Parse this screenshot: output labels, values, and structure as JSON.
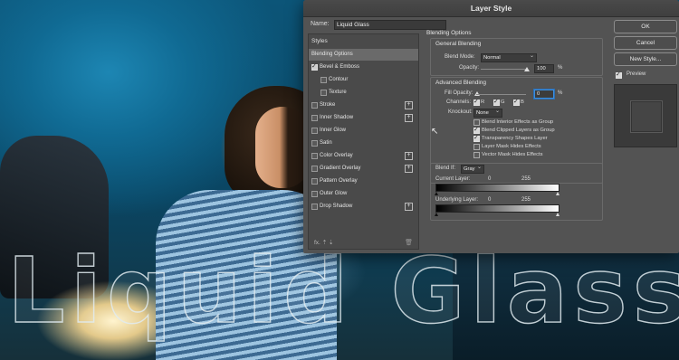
{
  "dialog": {
    "title": "Layer Style",
    "name_label": "Name:",
    "name_value": "Liquid Glass",
    "styles_header": "Styles",
    "styles": [
      {
        "label": "Blending Options",
        "checkbox": false,
        "checked": false,
        "plus": false,
        "selected": true
      },
      {
        "label": "Bevel & Emboss",
        "checkbox": true,
        "checked": true,
        "plus": false
      },
      {
        "label": "Contour",
        "checkbox": true,
        "checked": false,
        "plus": false,
        "indent": true
      },
      {
        "label": "Texture",
        "checkbox": true,
        "checked": false,
        "plus": false,
        "indent": true
      },
      {
        "label": "Stroke",
        "checkbox": true,
        "checked": false,
        "plus": true
      },
      {
        "label": "Inner Shadow",
        "checkbox": true,
        "checked": false,
        "plus": true
      },
      {
        "label": "Inner Glow",
        "checkbox": true,
        "checked": false,
        "plus": false
      },
      {
        "label": "Satin",
        "checkbox": true,
        "checked": false,
        "plus": false
      },
      {
        "label": "Color Overlay",
        "checkbox": true,
        "checked": false,
        "plus": true
      },
      {
        "label": "Gradient Overlay",
        "checkbox": true,
        "checked": false,
        "plus": true
      },
      {
        "label": "Pattern Overlay",
        "checkbox": true,
        "checked": false,
        "plus": false
      },
      {
        "label": "Outer Glow",
        "checkbox": true,
        "checked": false,
        "plus": false
      },
      {
        "label": "Drop Shadow",
        "checkbox": true,
        "checked": false,
        "plus": true
      }
    ],
    "footer_fx": "fx.",
    "blending": {
      "section_title": "Blending Options",
      "general_title": "General Blending",
      "blend_mode_label": "Blend Mode:",
      "blend_mode_value": "Normal",
      "opacity_label": "Opacity:",
      "opacity_value": "100",
      "pct": "%",
      "advanced_title": "Advanced Blending",
      "fill_opacity_label": "Fill Opacity:",
      "fill_opacity_value": "0",
      "channels_label": "Channels:",
      "channel_r": "R",
      "channel_g": "G",
      "channel_b": "B",
      "knockout_label": "Knockout:",
      "knockout_value": "None",
      "options": [
        {
          "label": "Blend Interior Effects as Group",
          "checked": false
        },
        {
          "label": "Blend Clipped Layers as Group",
          "checked": true
        },
        {
          "label": "Transparency Shapes Layer",
          "checked": true
        },
        {
          "label": "Layer Mask Hides Effects",
          "checked": false
        },
        {
          "label": "Vector Mask Hides Effects",
          "checked": false
        }
      ],
      "blend_if_label": "Blend If:",
      "blend_if_value": "Gray",
      "current_layer_label": "Current Layer:",
      "underlying_layer_label": "Underlying Layer:",
      "range_min": "0",
      "range_max": "255"
    },
    "buttons": {
      "ok": "OK",
      "cancel": "Cancel",
      "new_style": "New Style..."
    },
    "preview_label": "Preview",
    "preview_checked": true
  },
  "canvas": {
    "watermark_text": "Liquid Glass"
  }
}
